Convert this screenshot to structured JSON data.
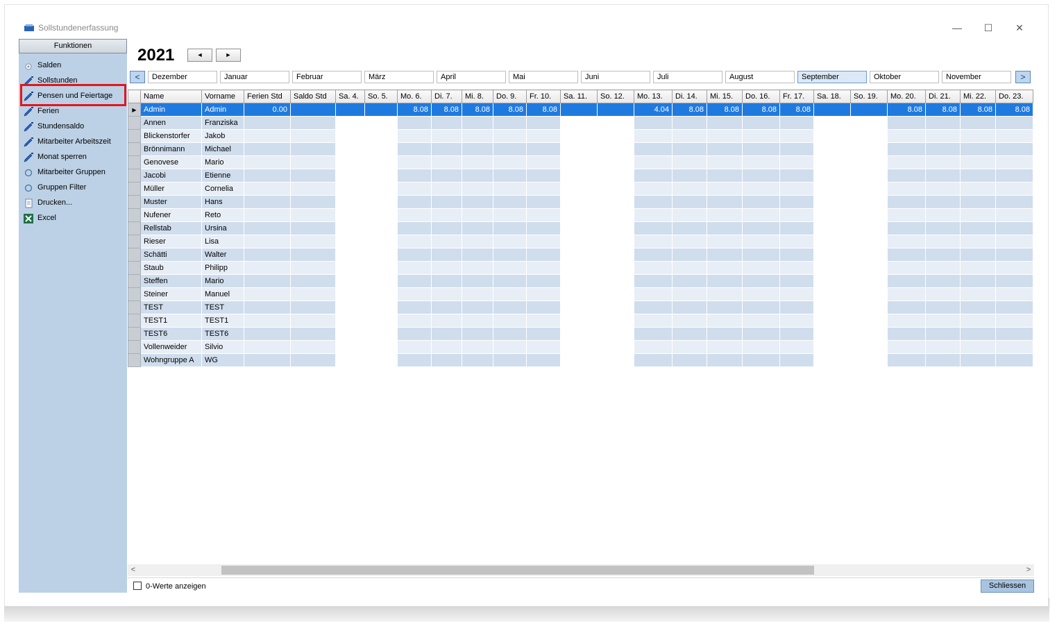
{
  "window": {
    "title": "Sollstundenerfassung",
    "minimize": "—",
    "maximize": "☐",
    "close": "✕"
  },
  "sidebar": {
    "header": "Funktionen",
    "items": [
      {
        "label": "Salden",
        "icon": "gear-icon"
      },
      {
        "label": "Sollstunden",
        "icon": "pencil-icon"
      },
      {
        "label": "Pensen und Feiertage",
        "icon": "pencil-icon"
      },
      {
        "label": "Ferien",
        "icon": "pencil-icon"
      },
      {
        "label": "Stundensaldo",
        "icon": "pencil-icon"
      },
      {
        "label": "Mitarbeiter Arbeitszeit",
        "icon": "pencil-icon"
      },
      {
        "label": "Monat sperren",
        "icon": "pencil-icon"
      },
      {
        "label": "Mitarbeiter Gruppen",
        "icon": "circle-icon"
      },
      {
        "label": "Gruppen Filter",
        "icon": "circle-icon"
      },
      {
        "label": "Drucken...",
        "icon": "document-icon"
      },
      {
        "label": "Excel",
        "icon": "excel-icon"
      }
    ]
  },
  "toolbar": {
    "year": "2021",
    "prev": "◄",
    "next": "►"
  },
  "monthbar": {
    "left_arrow": "<",
    "right_arrow": ">",
    "months": [
      "Dezember",
      "Januar",
      "Februar",
      "März",
      "April",
      "Mai",
      "Juni",
      "Juli",
      "August",
      "September",
      "Oktober",
      "November"
    ],
    "selected": "September"
  },
  "grid": {
    "columns": [
      "Name",
      "Vorname",
      "Ferien Std",
      "Saldo Std",
      "Sa. 4.",
      "So. 5.",
      "Mo. 6.",
      "Di. 7.",
      "Mi. 8.",
      "Do. 9.",
      "Fr. 10.",
      "Sa. 11.",
      "So. 12.",
      "Mo. 13.",
      "Di. 14.",
      "Mi. 15.",
      "Do. 16.",
      "Fr. 17.",
      "Sa. 18.",
      "So. 19.",
      "Mo. 20.",
      "Di. 21.",
      "Mi. 22.",
      "Do. 23."
    ],
    "rows": [
      [
        "Admin",
        "Admin",
        "0.00",
        "",
        "",
        "",
        "8.08",
        "8.08",
        "8.08",
        "8.08",
        "8.08",
        "",
        "",
        "4.04",
        "8.08",
        "8.08",
        "8.08",
        "8.08",
        "",
        "",
        "8.08",
        "8.08",
        "8.08",
        "8.08"
      ],
      [
        "Annen",
        "Franziska"
      ],
      [
        "Blickenstorfer",
        "Jakob"
      ],
      [
        "Brönnimann",
        "Michael"
      ],
      [
        "Genovese",
        "Mario"
      ],
      [
        "Jacobi",
        "Etienne"
      ],
      [
        "Müller",
        "Cornelia"
      ],
      [
        "Muster",
        "Hans"
      ],
      [
        "Nufener",
        "Reto"
      ],
      [
        "Rellstab",
        "Ursina"
      ],
      [
        "Rieser",
        "Lisa"
      ],
      [
        "Schätti",
        "Walter"
      ],
      [
        "Staub",
        "Philipp"
      ],
      [
        "Steffen",
        "Mario"
      ],
      [
        "Steiner",
        "Manuel"
      ],
      [
        "TEST",
        "TEST"
      ],
      [
        "TEST1",
        "TEST1"
      ],
      [
        "TEST6",
        "TEST6"
      ],
      [
        "Vollenweider",
        "Silvio"
      ],
      [
        "Wohngruppe A",
        "WG"
      ]
    ],
    "selected_row": 0
  },
  "footer": {
    "checkbox_label": "0-Werte anzeigen",
    "close_button": "Schliessen"
  },
  "colors": {
    "selected_row": "#1f7ae0",
    "sidebar": "#bcd1e6",
    "highlight": "#e3161c"
  }
}
